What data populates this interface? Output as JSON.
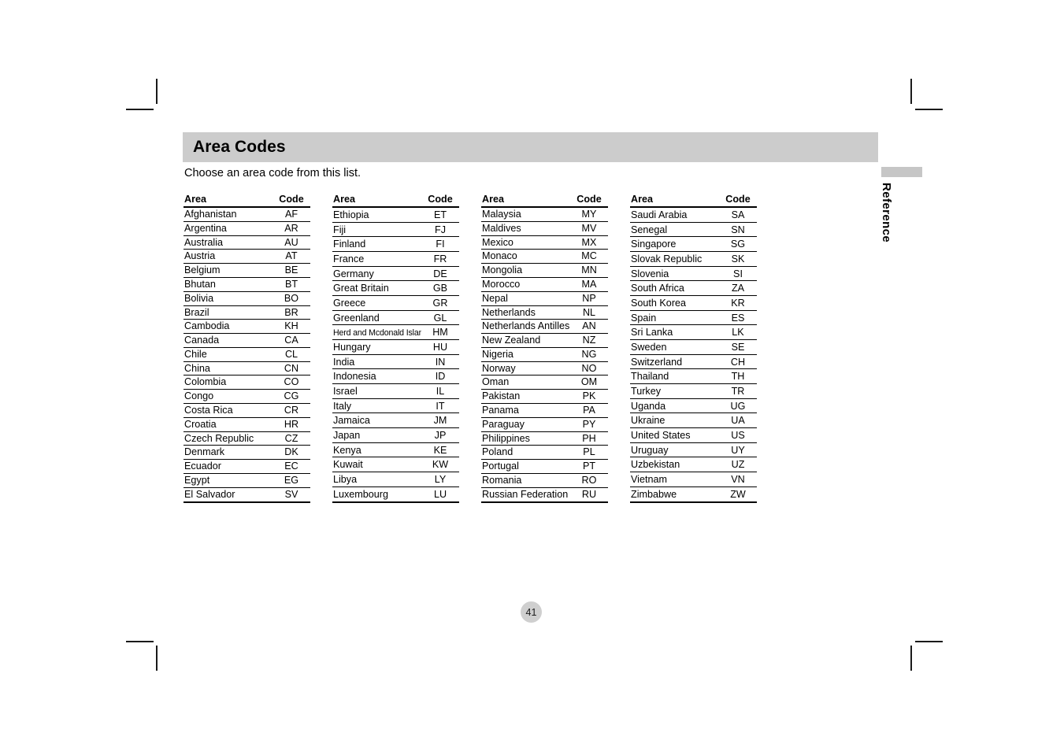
{
  "page": {
    "title": "Area Codes",
    "intro": "Choose an area code from this list.",
    "page_number": "41",
    "side_tab_label": "Reference",
    "title_bar_color": "#cccccc",
    "side_tab_color": "#c6c6c6",
    "page_number_bg": "#cfcfcf"
  },
  "table_headers": {
    "area": "Area",
    "code": "Code"
  },
  "columns": [
    {
      "rows": [
        {
          "area": "Afghanistan",
          "code": "AF"
        },
        {
          "area": "Argentina",
          "code": "AR"
        },
        {
          "area": "Australia",
          "code": "AU"
        },
        {
          "area": "Austria",
          "code": "AT"
        },
        {
          "area": "Belgium",
          "code": "BE"
        },
        {
          "area": "Bhutan",
          "code": "BT"
        },
        {
          "area": "Bolivia",
          "code": "BO"
        },
        {
          "area": "Brazil",
          "code": "BR"
        },
        {
          "area": "Cambodia",
          "code": "KH"
        },
        {
          "area": "Canada",
          "code": "CA"
        },
        {
          "area": "Chile",
          "code": "CL"
        },
        {
          "area": "China",
          "code": "CN"
        },
        {
          "area": "Colombia",
          "code": "CO"
        },
        {
          "area": "Congo",
          "code": "CG"
        },
        {
          "area": "Costa Rica",
          "code": "CR"
        },
        {
          "area": "Croatia",
          "code": "HR"
        },
        {
          "area": "Czech Republic",
          "code": "CZ"
        },
        {
          "area": "Denmark",
          "code": "DK"
        },
        {
          "area": "Ecuador",
          "code": "EC"
        },
        {
          "area": "Egypt",
          "code": "EG"
        },
        {
          "area": "El Salvador",
          "code": "SV"
        }
      ]
    },
    {
      "rows": [
        {
          "area": "Ethiopia",
          "code": "ET"
        },
        {
          "area": "Fiji",
          "code": "FJ"
        },
        {
          "area": "Finland",
          "code": "FI"
        },
        {
          "area": "France",
          "code": "FR"
        },
        {
          "area": "Germany",
          "code": "DE"
        },
        {
          "area": "Great Britain",
          "code": "GB"
        },
        {
          "area": "Greece",
          "code": "GR"
        },
        {
          "area": "Greenland",
          "code": "GL"
        },
        {
          "area": "Herd and Mcdonald Islands",
          "code": "HM",
          "condensed": true
        },
        {
          "area": "Hungary",
          "code": "HU"
        },
        {
          "area": "India",
          "code": "IN"
        },
        {
          "area": "Indonesia",
          "code": "ID"
        },
        {
          "area": "Israel",
          "code": "IL"
        },
        {
          "area": "Italy",
          "code": "IT"
        },
        {
          "area": "Jamaica",
          "code": "JM"
        },
        {
          "area": "Japan",
          "code": "JP"
        },
        {
          "area": "Kenya",
          "code": "KE"
        },
        {
          "area": "Kuwait",
          "code": "KW"
        },
        {
          "area": "Libya",
          "code": "LY"
        },
        {
          "area": "Luxembourg",
          "code": "LU"
        }
      ]
    },
    {
      "rows": [
        {
          "area": "Malaysia",
          "code": "MY"
        },
        {
          "area": "Maldives",
          "code": "MV"
        },
        {
          "area": "Mexico",
          "code": "MX"
        },
        {
          "area": "Monaco",
          "code": "MC"
        },
        {
          "area": "Mongolia",
          "code": "MN"
        },
        {
          "area": "Morocco",
          "code": "MA"
        },
        {
          "area": "Nepal",
          "code": "NP"
        },
        {
          "area": "Netherlands",
          "code": "NL"
        },
        {
          "area": "Netherlands Antilles",
          "code": "AN"
        },
        {
          "area": "New Zealand",
          "code": "NZ"
        },
        {
          "area": "Nigeria",
          "code": "NG"
        },
        {
          "area": "Norway",
          "code": "NO"
        },
        {
          "area": "Oman",
          "code": "OM"
        },
        {
          "area": "Pakistan",
          "code": "PK"
        },
        {
          "area": "Panama",
          "code": "PA"
        },
        {
          "area": "Paraguay",
          "code": "PY"
        },
        {
          "area": "Philippines",
          "code": "PH"
        },
        {
          "area": "Poland",
          "code": "PL"
        },
        {
          "area": "Portugal",
          "code": "PT"
        },
        {
          "area": "Romania",
          "code": "RO"
        },
        {
          "area": "Russian Federation",
          "code": "RU"
        }
      ]
    },
    {
      "rows": [
        {
          "area": "Saudi Arabia",
          "code": "SA"
        },
        {
          "area": "Senegal",
          "code": "SN"
        },
        {
          "area": "Singapore",
          "code": "SG"
        },
        {
          "area": "Slovak Republic",
          "code": "SK"
        },
        {
          "area": "Slovenia",
          "code": "SI"
        },
        {
          "area": "South Africa",
          "code": "ZA"
        },
        {
          "area": "South Korea",
          "code": "KR"
        },
        {
          "area": "Spain",
          "code": "ES"
        },
        {
          "area": "Sri Lanka",
          "code": "LK"
        },
        {
          "area": "Sweden",
          "code": "SE"
        },
        {
          "area": "Switzerland",
          "code": "CH"
        },
        {
          "area": "Thailand",
          "code": "TH"
        },
        {
          "area": "Turkey",
          "code": "TR"
        },
        {
          "area": "Uganda",
          "code": "UG"
        },
        {
          "area": "Ukraine",
          "code": "UA"
        },
        {
          "area": "United States",
          "code": "US"
        },
        {
          "area": "Uruguay",
          "code": "UY"
        },
        {
          "area": "Uzbekistan",
          "code": "UZ"
        },
        {
          "area": "Vietnam",
          "code": "VN"
        },
        {
          "area": "Zimbabwe",
          "code": "ZW"
        }
      ]
    }
  ]
}
